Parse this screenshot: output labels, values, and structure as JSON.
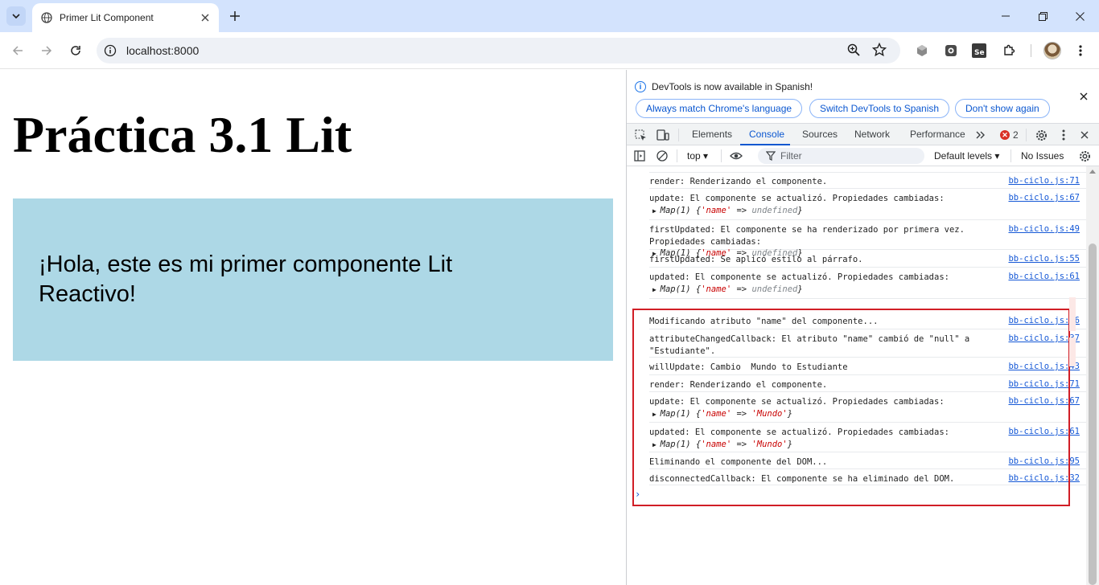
{
  "browser": {
    "tab_title": "Primer Lit Component",
    "url": "localhost:8000"
  },
  "page": {
    "heading": "Práctica 3.1 Lit",
    "component_text": "¡Hola, este es mi primer componente Lit Reactivo!",
    "component_bg": "#add8e6"
  },
  "devtools": {
    "infobar": {
      "message": "DevTools is now available in Spanish!",
      "btn_match": "Always match Chrome's language",
      "btn_switch": "Switch DevTools to Spanish",
      "btn_dont": "Don't show again"
    },
    "tabs": [
      "Elements",
      "Console",
      "Sources",
      "Network",
      "Performance"
    ],
    "active_tab": "Console",
    "error_count": "2",
    "context": "top",
    "filter_placeholder": "Filter",
    "levels": "Default levels",
    "issues": "No Issues",
    "logs_upper": [
      {
        "text": "render: Renderizando el componente.",
        "src": "bb-ciclo.js:71"
      },
      {
        "text": "update: El componente se actualizó. Propiedades cambiadas:",
        "map_prefix": "Map(1) {",
        "key": "'name'",
        "arrow": " => ",
        "value": "undefined",
        "value_kind": "undef",
        "src": "bb-ciclo.js:67"
      },
      {
        "text": "firstUpdated: El componente se ha renderizado por primera vez. Propiedades cambiadas:",
        "map_prefix": "Map(1) {",
        "key": "'name'",
        "arrow": " => ",
        "value": "undefined",
        "value_kind": "undef",
        "src": "bb-ciclo.js:49"
      },
      {
        "text": "firstUpdated: Se aplicó estilo al párrafo.",
        "src": "bb-ciclo.js:55"
      },
      {
        "text": "updated: El componente se actualizó. Propiedades cambiadas:",
        "map_prefix": "Map(1) {",
        "key": "'name'",
        "arrow": " => ",
        "value": "undefined",
        "value_kind": "undef",
        "src": "bb-ciclo.js:61"
      }
    ],
    "logs_lower": [
      {
        "text": "Modificando atributo \"name\" del componente...",
        "src": "bb-ciclo.js:86"
      },
      {
        "text": "attributeChangedCallback: El atributo \"name\" cambió de \"null\" a \"Estudiante\".",
        "src": "bb-ciclo.js:37"
      },
      {
        "text": "willUpdate: Cambio  Mundo to Estudiante",
        "src": "bb-ciclo.js:43"
      },
      {
        "text": "render: Renderizando el componente.",
        "src": "bb-ciclo.js:71"
      },
      {
        "text": "update: El componente se actualizó. Propiedades cambiadas:",
        "map_prefix": "Map(1) {",
        "key": "'name'",
        "arrow": " => ",
        "value": "'Mundo'",
        "value_kind": "str",
        "src": "bb-ciclo.js:67"
      },
      {
        "text": "updated: El componente se actualizó. Propiedades cambiadas:",
        "map_prefix": "Map(1) {",
        "key": "'name'",
        "arrow": " => ",
        "value": "'Mundo'",
        "value_kind": "str",
        "src": "bb-ciclo.js:61"
      },
      {
        "text": "Eliminando el componente del DOM...",
        "src": "bb-ciclo.js:95"
      },
      {
        "text": "disconnectedCallback: El componente se ha eliminado del DOM.",
        "src": "bb-ciclo.js:32"
      }
    ]
  }
}
